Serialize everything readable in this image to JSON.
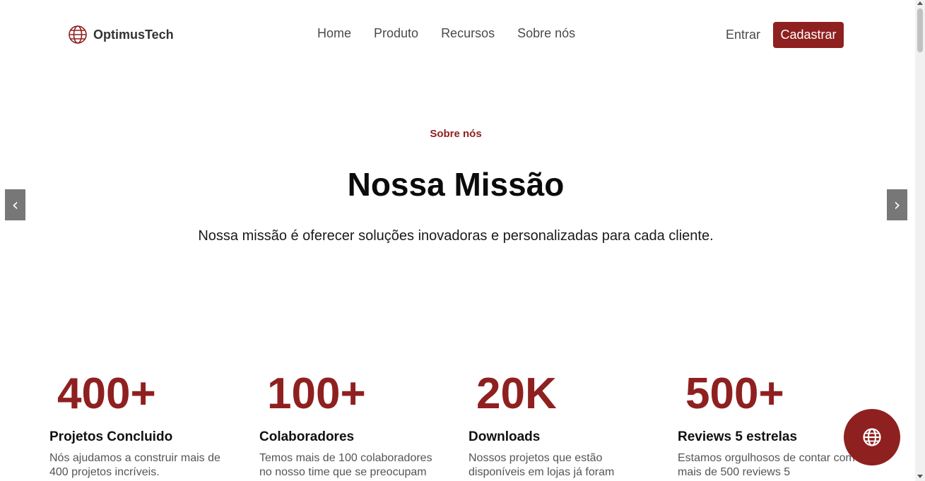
{
  "header": {
    "brand": "OptimusTech",
    "nav": [
      "Home",
      "Produto",
      "Recursos",
      "Sobre nós"
    ],
    "login": "Entrar",
    "signup": "Cadastrar"
  },
  "hero": {
    "eyebrow": "Sobre nós",
    "title": "Nossa Missão",
    "text": "Nossa missão é oferecer soluções inovadoras e personalizadas para cada cliente.",
    "prev_icon": "‹",
    "next_icon": "›"
  },
  "stats": [
    {
      "value": "400+",
      "label": "Projetos Concluido",
      "desc": "Nós ajudamos a construir mais de 400 projetos incríveis."
    },
    {
      "value": "100+",
      "label": "Colaboradores",
      "desc": "Temos mais de 100 colaboradores no nosso time que se preocupam"
    },
    {
      "value": "20K",
      "label": "Downloads",
      "desc": "Nossos projetos que estão disponíveis em lojas já foram"
    },
    {
      "value": "500+",
      "label": "Reviews 5 estrelas",
      "desc": "Estamos orgulhosos de contar com mais de 500 reviews 5"
    }
  ],
  "colors": {
    "accent": "#8f2020",
    "text": "#111111",
    "muted": "#555555"
  },
  "icons": {
    "brand": "globe-icon",
    "language": "globe-icon"
  }
}
